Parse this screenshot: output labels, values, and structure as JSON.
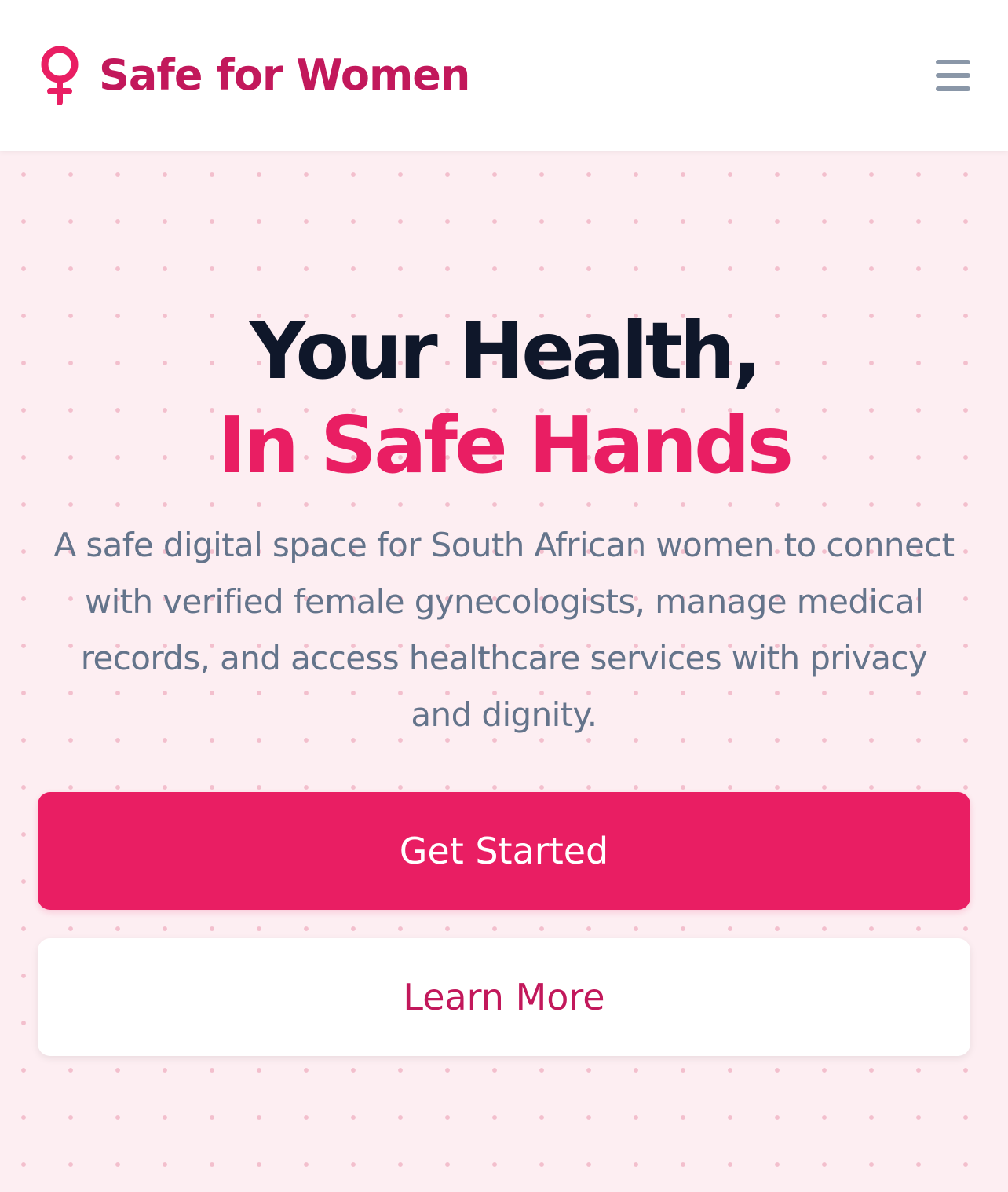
{
  "colors": {
    "brand": "#c2185b",
    "accent": "#e91e63",
    "title_dark": "#0f172a",
    "body_text": "#64748b",
    "menu_icon": "#8a97a8",
    "hero_background": "#fdeef2",
    "white": "#ffffff"
  },
  "header": {
    "brand_icon": "female-symbol-icon",
    "brand_name": "Safe for Women",
    "menu_icon": "hamburger-menu-icon"
  },
  "hero": {
    "title_line1": "Your Health,",
    "title_line2": "In Safe Hands",
    "description": "A safe digital space for South African women to connect with verified female gynecologists, manage medical records, and access healthcare services with privacy and dignity.",
    "primary_button": "Get Started",
    "secondary_button": "Learn More"
  }
}
